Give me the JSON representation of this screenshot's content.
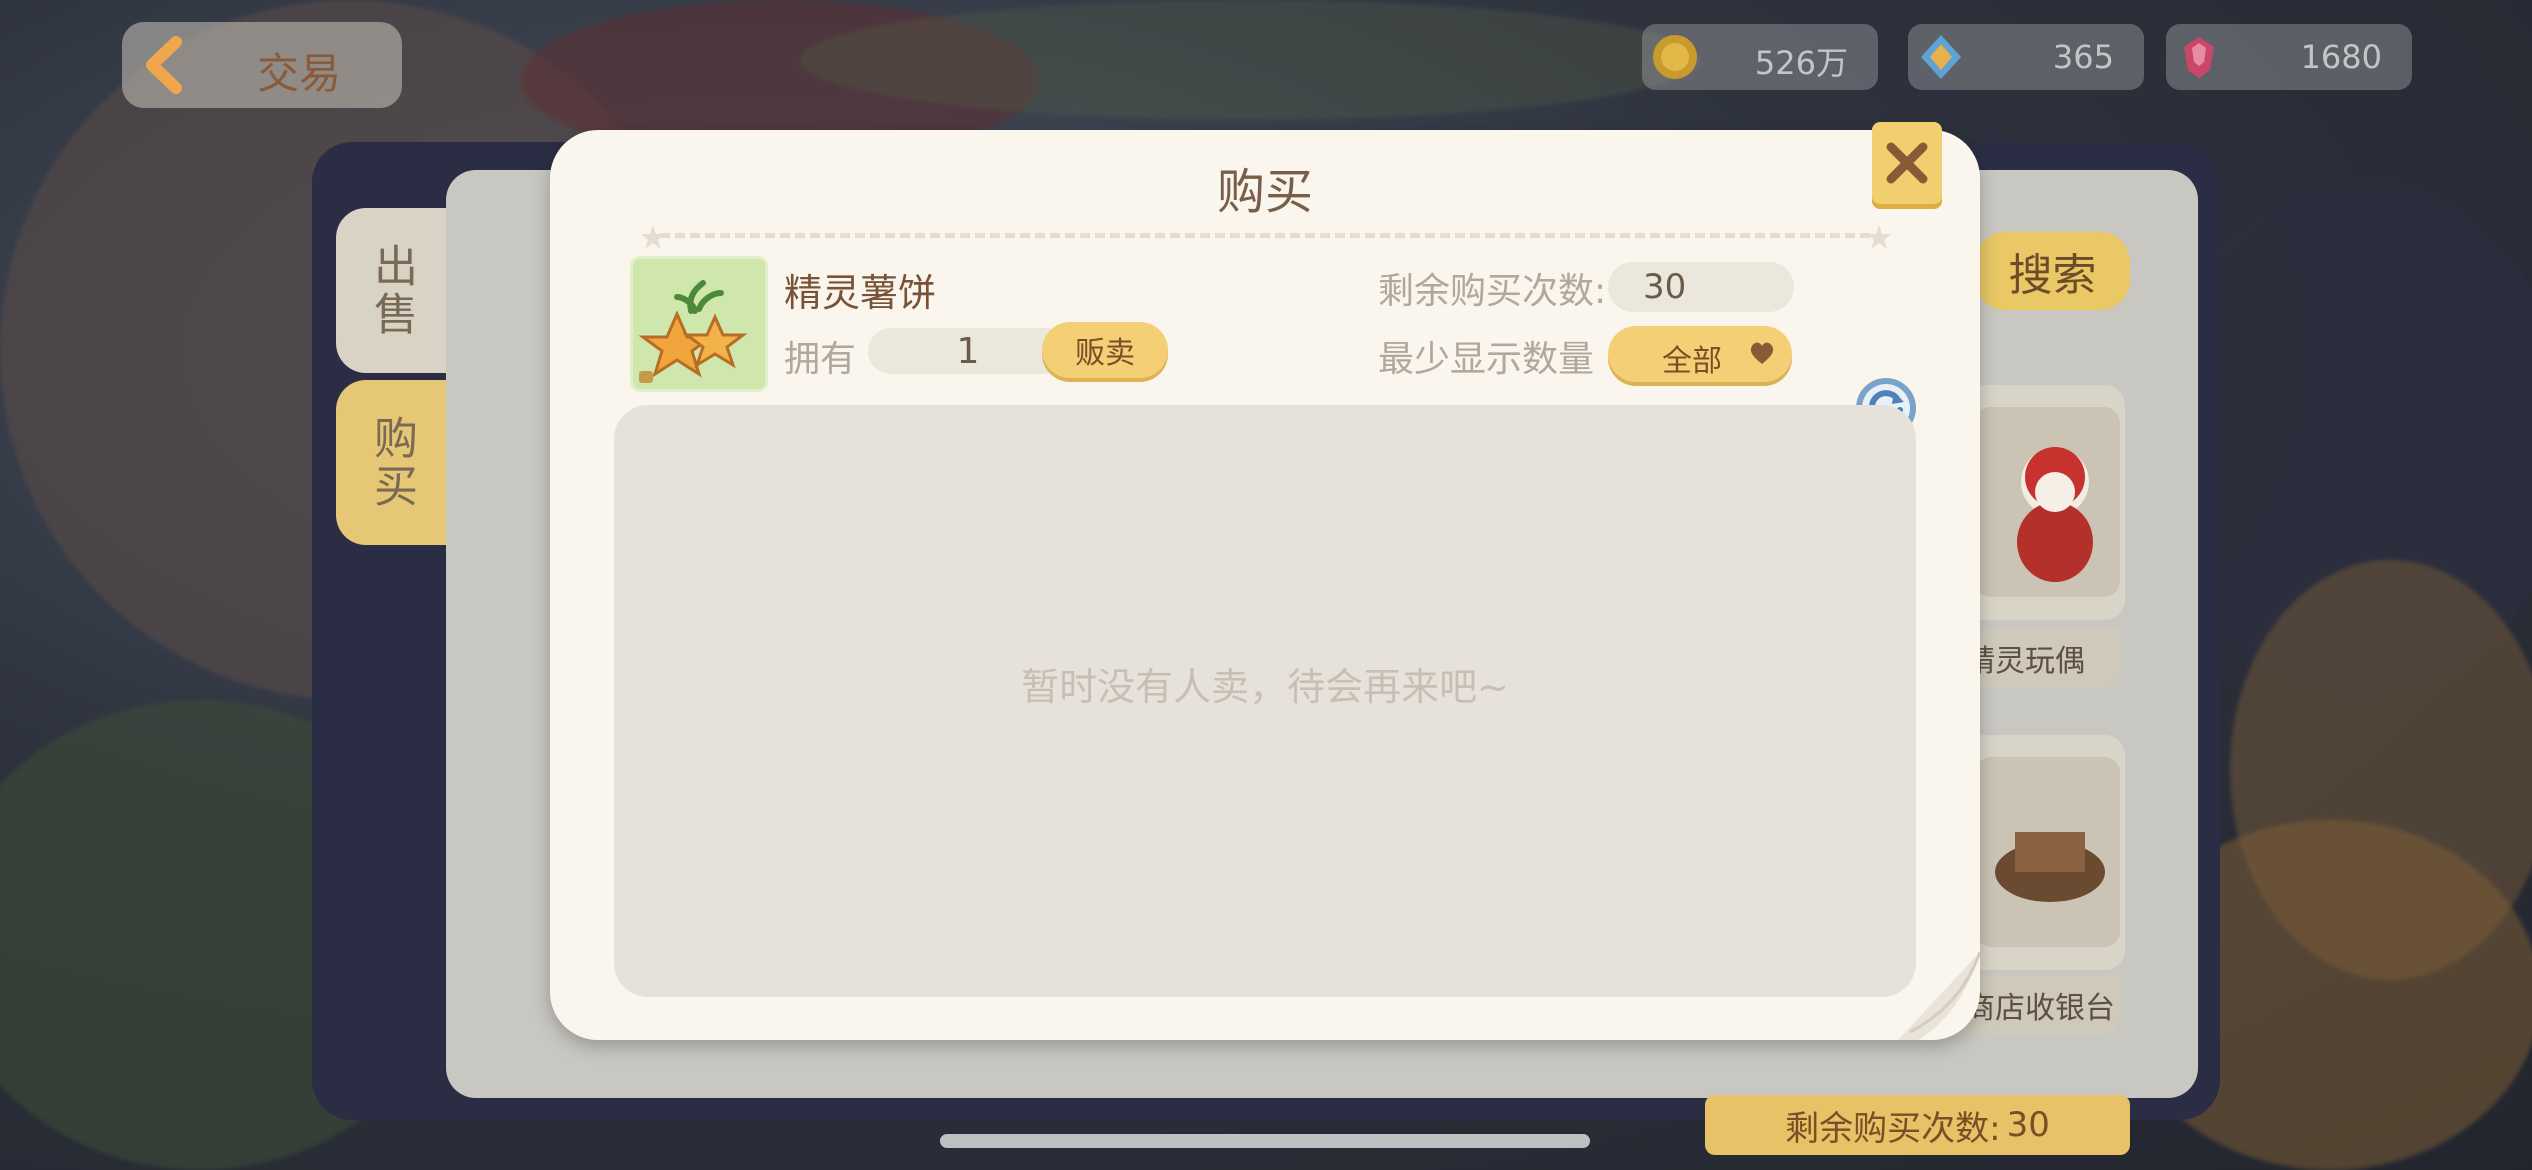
{
  "nav": {
    "title": "交易",
    "back_icon": "back-arrow-icon"
  },
  "currency": [
    {
      "icon": "coin-icon",
      "value": "526万"
    },
    {
      "icon": "crystal-icon",
      "value": "365"
    },
    {
      "icon": "gem-icon",
      "value": "1680"
    }
  ],
  "side_tabs": {
    "sell": "出售",
    "buy": "购买"
  },
  "background": {
    "search_label": "搜索",
    "cards": [
      {
        "label": "精灵玩偶"
      },
      {
        "label": "皮商店收银台"
      }
    ],
    "remain_label": "剩余购买次数:",
    "remain_value": "30"
  },
  "modal": {
    "title": "购买",
    "item_name": "精灵薯饼",
    "own_label": "拥有",
    "own_value": "1",
    "sell_button": "贩卖",
    "remaining_label": "剩余购买次数:",
    "remaining_value": "30",
    "min_display_label": "最少显示数量",
    "min_display_value": "全部",
    "empty_message": "暂时没有人卖，待会再来吧~"
  },
  "colors": {
    "accent": "#f4cf76",
    "panel": "#faf6ee",
    "dark_panel": "#2b2d44"
  }
}
